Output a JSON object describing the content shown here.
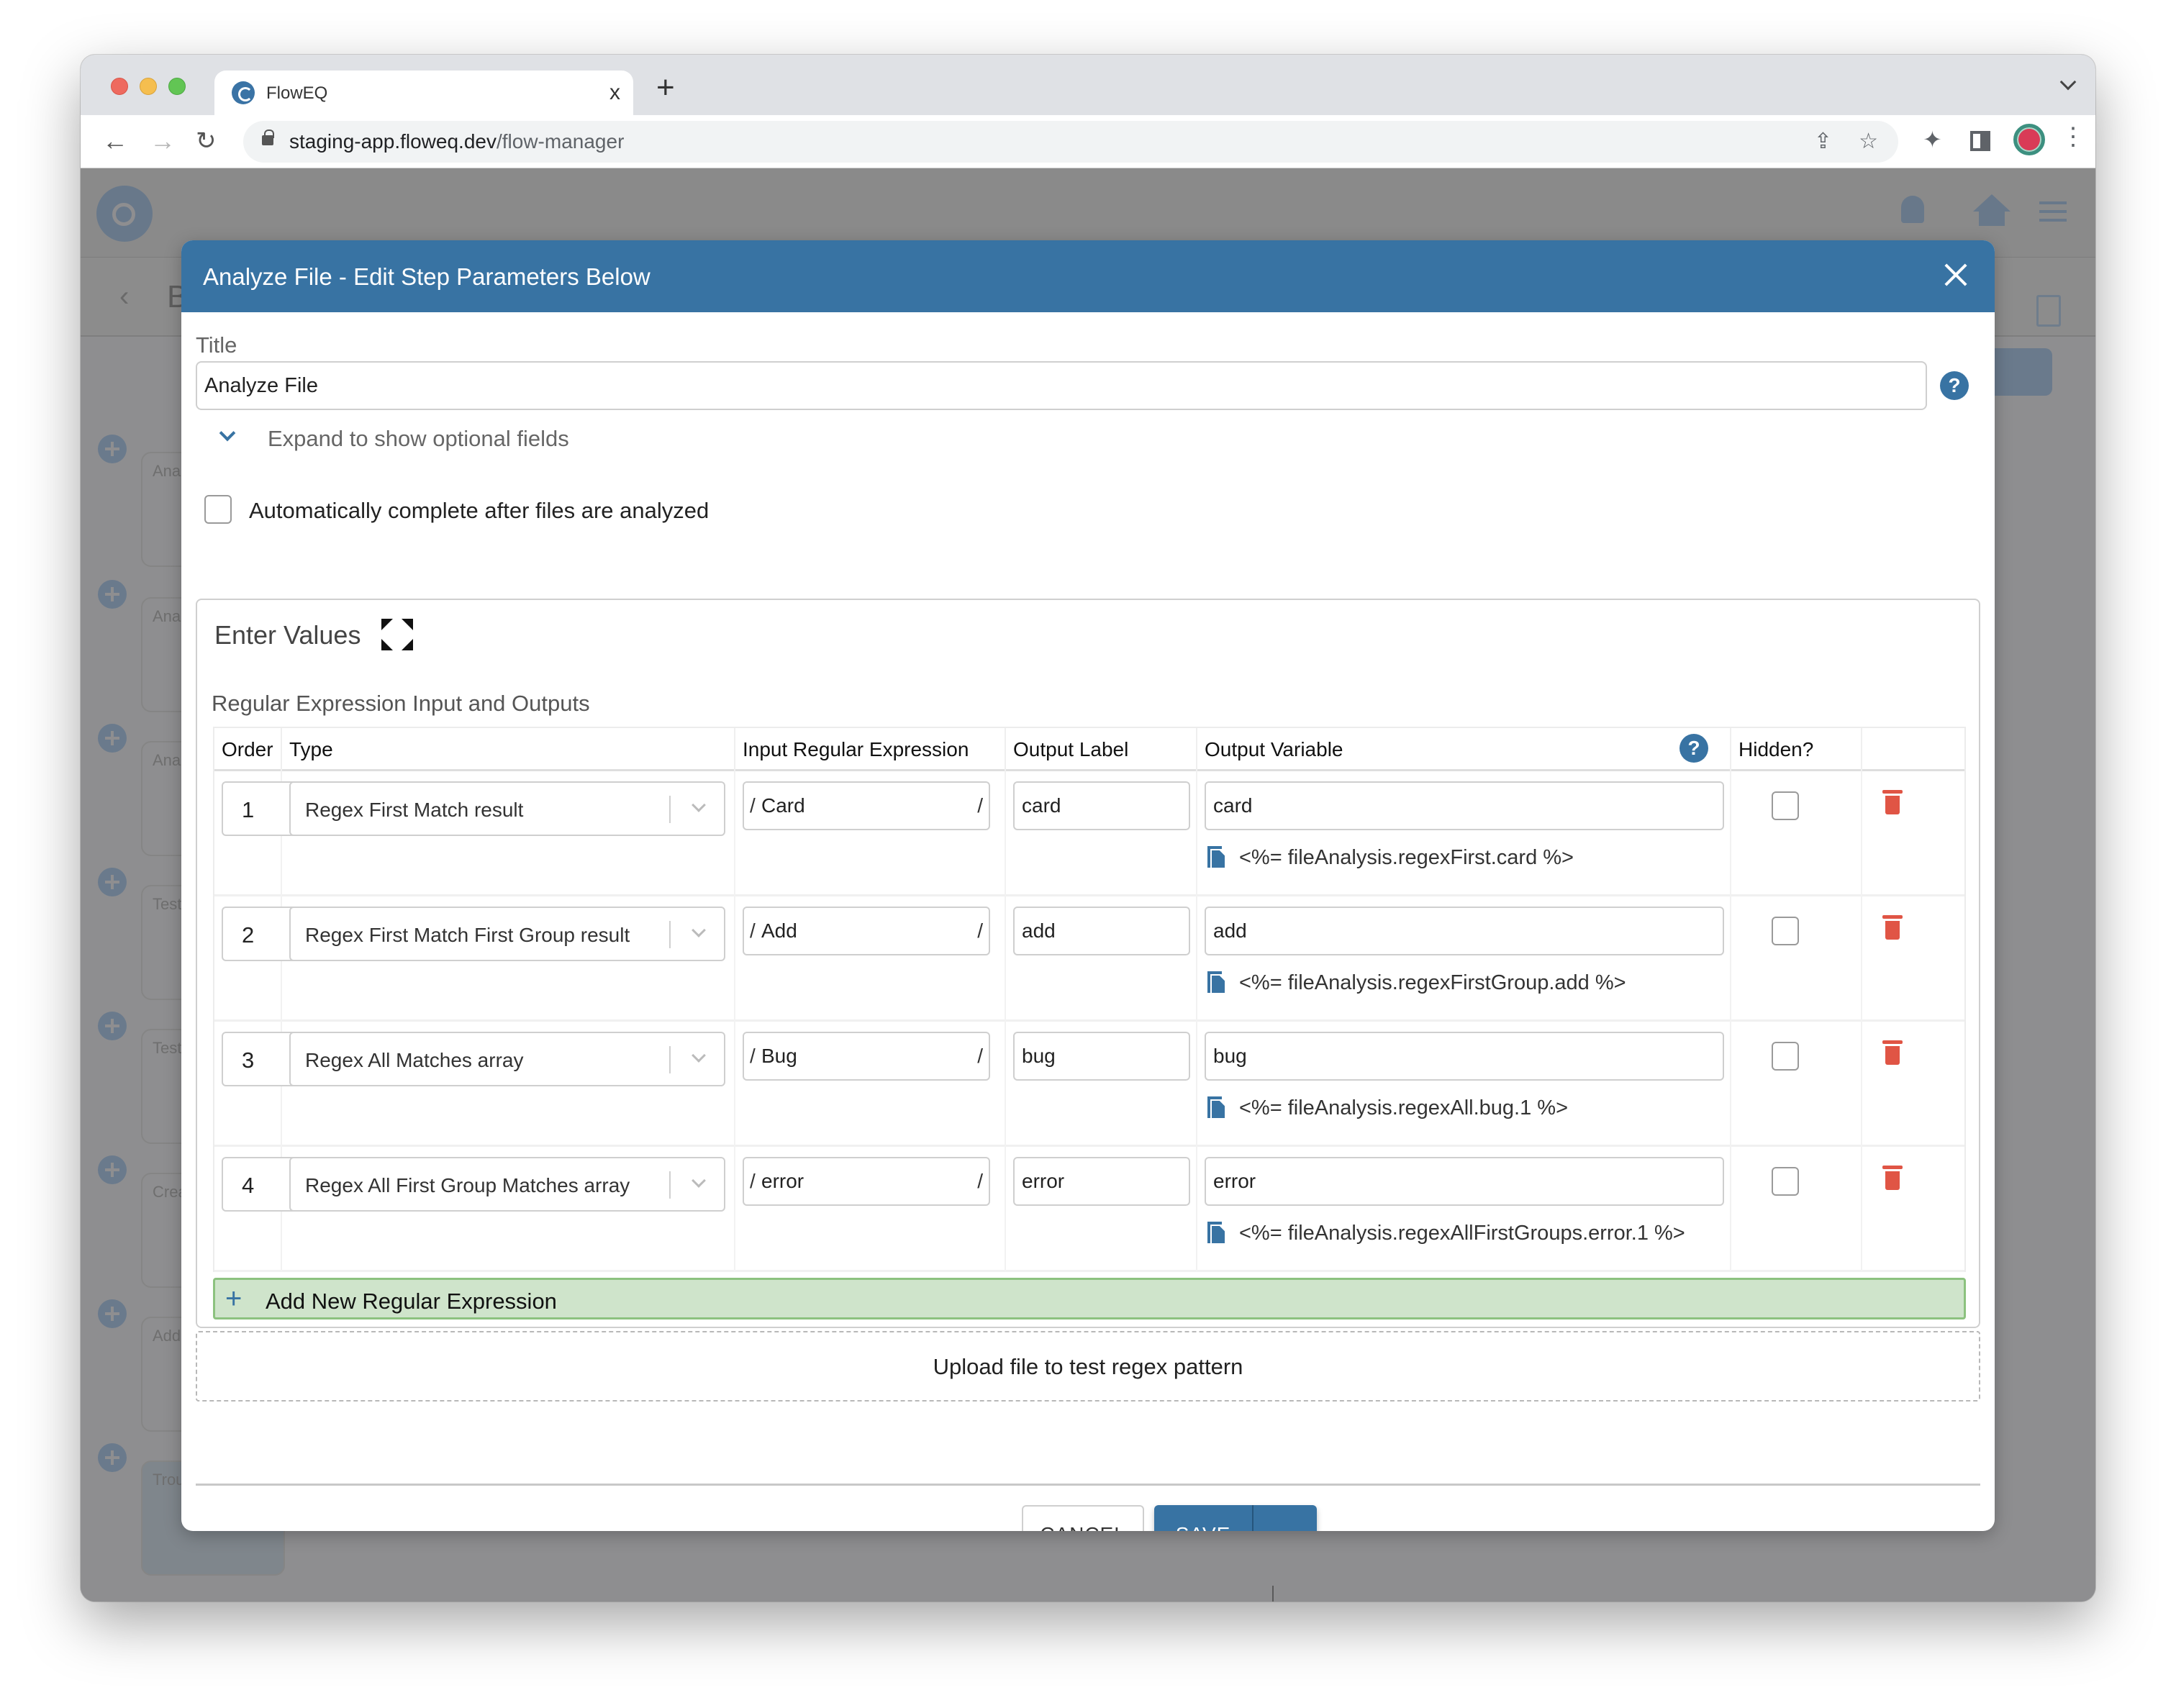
{
  "browser": {
    "tab_title": "FlowEQ",
    "tab_close": "x",
    "new_tab": "+",
    "url_host": "staging-app.floweq.dev",
    "url_path": "/flow-manager",
    "nav": {
      "back": "←",
      "forward": "→",
      "reload": "↻"
    },
    "icons": {
      "share": "⇪",
      "star": "☆",
      "extensions": "✦",
      "menu": "⋮"
    }
  },
  "background_app": {
    "back_glyph": "‹",
    "title_initial": "B",
    "step_cards": [
      "Ana",
      "Ana",
      "Ana",
      "Test",
      "Test",
      "Crea",
      "Add",
      "Trou"
    ]
  },
  "modal": {
    "title": "Analyze File - Edit Step Parameters Below",
    "title_field": {
      "label": "Title",
      "value": "Analyze File",
      "help": "?"
    },
    "expand_label": "Expand to show optional fields",
    "auto_complete": {
      "label": "Automatically complete after files are analyzed",
      "checked": false
    },
    "values_section": {
      "title": "Enter Values",
      "subtitle": "Regular Expression Input and Outputs",
      "columns": [
        "Order",
        "Type",
        "Input Regular Expression",
        "Output Label",
        "Output Variable",
        "Hidden?"
      ],
      "output_variable_help": "?",
      "regex_delimiter": "/",
      "rows": [
        {
          "order": "1",
          "type": "Regex First Match result",
          "regex": "Card",
          "label": "card",
          "variable": "card",
          "hint": "<%= fileAnalysis.regexFirst.card %>",
          "hidden": false
        },
        {
          "order": "2",
          "type": "Regex First Match First Group result",
          "regex": "Add",
          "label": "add",
          "variable": "add",
          "hint": "<%= fileAnalysis.regexFirstGroup.add %>",
          "hidden": false
        },
        {
          "order": "3",
          "type": "Regex All Matches array",
          "regex": "Bug",
          "label": "bug",
          "variable": "bug",
          "hint": "<%= fileAnalysis.regexAll.bug.1 %>",
          "hidden": false
        },
        {
          "order": "4",
          "type": "Regex All First Group Matches array",
          "regex": "error",
          "label": "error",
          "variable": "error",
          "hint": "<%= fileAnalysis.regexAllFirstGroups.error.1 %>",
          "hidden": false
        }
      ],
      "add_plus": "+",
      "add_label": "Add New Regular Expression"
    },
    "upload_label": "Upload file to test regex pattern",
    "footer": {
      "cancel": "CANCEL",
      "save": "SAVE"
    }
  },
  "colors": {
    "primary": "#3873a3",
    "danger": "#e05545",
    "add_row_bg": "#cfe4cb",
    "add_row_border": "#8cc27f",
    "overlay": "#8e8e90"
  }
}
